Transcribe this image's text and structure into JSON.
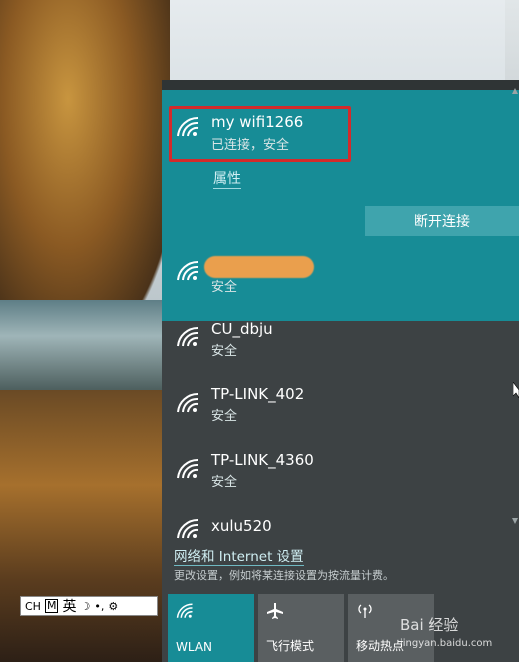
{
  "wifi_panel": {
    "connected": {
      "name": "my wifi1266",
      "status": "已连接，安全",
      "properties_link": "属性",
      "disconnect_button": "断开连接"
    },
    "networks": [
      {
        "name": "",
        "security": "安全"
      },
      {
        "name": "CU_dbju",
        "security": "安全"
      },
      {
        "name": "TP-LINK_402",
        "security": "安全"
      },
      {
        "name": "TP-LINK_4360",
        "security": "安全"
      },
      {
        "name": "xulu520",
        "security": ""
      }
    ],
    "settings_link": "网络和 Internet 设置",
    "settings_desc": "更改设置，例如将某连接设置为按流量计费。"
  },
  "quick_actions": [
    {
      "label": "WLAN",
      "icon": "wifi-icon",
      "active": true
    },
    {
      "label": "飞行模式",
      "icon": "airplane-icon",
      "active": false
    },
    {
      "label": "移动热点",
      "icon": "hotspot-icon",
      "active": false
    }
  ],
  "ime_bar": {
    "lang": "CH",
    "mode_box": "M",
    "input": "英",
    "icon1": "moon-icon",
    "icon2": "punctuation-icon",
    "icon3": "gear-icon"
  },
  "colors": {
    "accent": "#178c96",
    "panel_bg": "#3d4244",
    "highlight": "#d42a2a"
  },
  "watermark": {
    "text": "Bai 经验",
    "sub": "jingyan.baidu.com"
  }
}
